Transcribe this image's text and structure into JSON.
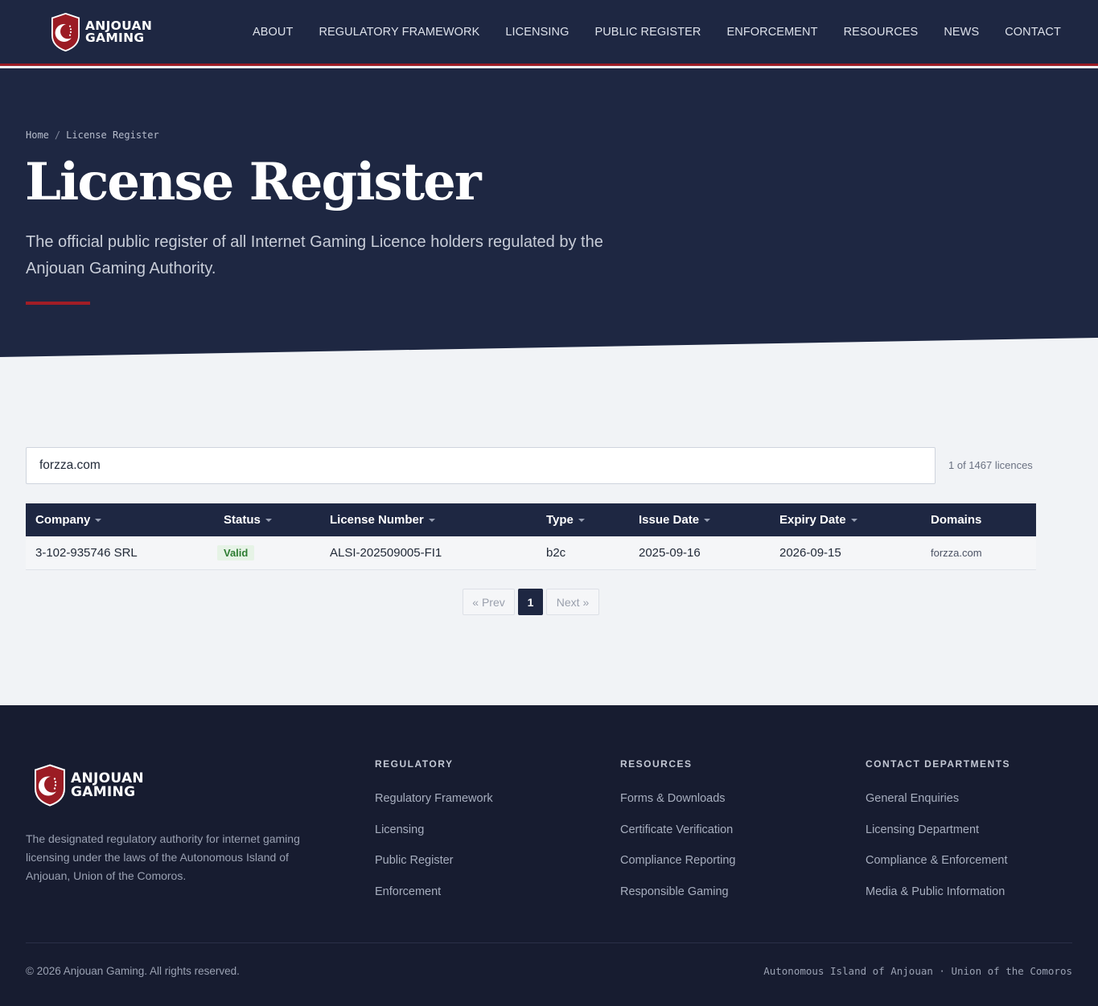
{
  "brand": {
    "line1": "ANJOUAN",
    "line2": "GAMING",
    "colors": {
      "navy": "#1e2742",
      "crimson": "#9b1c24",
      "footer": "#171c30",
      "valid_green": "#2e7d32"
    }
  },
  "nav": {
    "items": [
      "ABOUT",
      "REGULATORY FRAMEWORK",
      "LICENSING",
      "PUBLIC REGISTER",
      "ENFORCEMENT",
      "RESOURCES",
      "NEWS",
      "CONTACT"
    ]
  },
  "breadcrumb": {
    "home": "Home",
    "separator": "/",
    "current": "License Register"
  },
  "hero": {
    "title": "License Register",
    "subtitle": "The official public register of all Internet Gaming Licence holders regulated by the Anjouan Gaming Authority."
  },
  "search": {
    "value": "forzza.com",
    "count_text": "1 of 1467 licences"
  },
  "table": {
    "headers": {
      "company": "Company",
      "status": "Status",
      "license_number": "License Number",
      "type": "Type",
      "issue_date": "Issue Date",
      "expiry_date": "Expiry Date",
      "domains": "Domains"
    },
    "rows": [
      {
        "company": "3-102-935746 SRL",
        "status": "Valid",
        "license_number": "ALSI-202509005-FI1",
        "type": "b2c",
        "issue_date": "2025-09-16",
        "expiry_date": "2026-09-15",
        "domains": "forzza.com"
      }
    ]
  },
  "pagination": {
    "prev": "« Prev",
    "current": "1",
    "next": "Next »"
  },
  "footer": {
    "description": "The designated regulatory authority for internet gaming licensing under the laws of the Autonomous Island of Anjouan, Union of the Comoros.",
    "columns": [
      {
        "title": "REGULATORY",
        "links": [
          "Regulatory Framework",
          "Licensing",
          "Public Register",
          "Enforcement"
        ]
      },
      {
        "title": "RESOURCES",
        "links": [
          "Forms & Downloads",
          "Certificate Verification",
          "Compliance Reporting",
          "Responsible Gaming"
        ]
      },
      {
        "title": "CONTACT DEPARTMENTS",
        "links": [
          "General Enquiries",
          "Licensing Department",
          "Compliance & Enforcement",
          "Media & Public Information"
        ]
      }
    ],
    "copyright": "© 2026 Anjouan Gaming. All rights reserved.",
    "locale": "Autonomous Island of Anjouan · Union of the Comoros"
  },
  "icons": {
    "logo": "crescent-shield-icon",
    "sort": "caret-down-icon"
  }
}
